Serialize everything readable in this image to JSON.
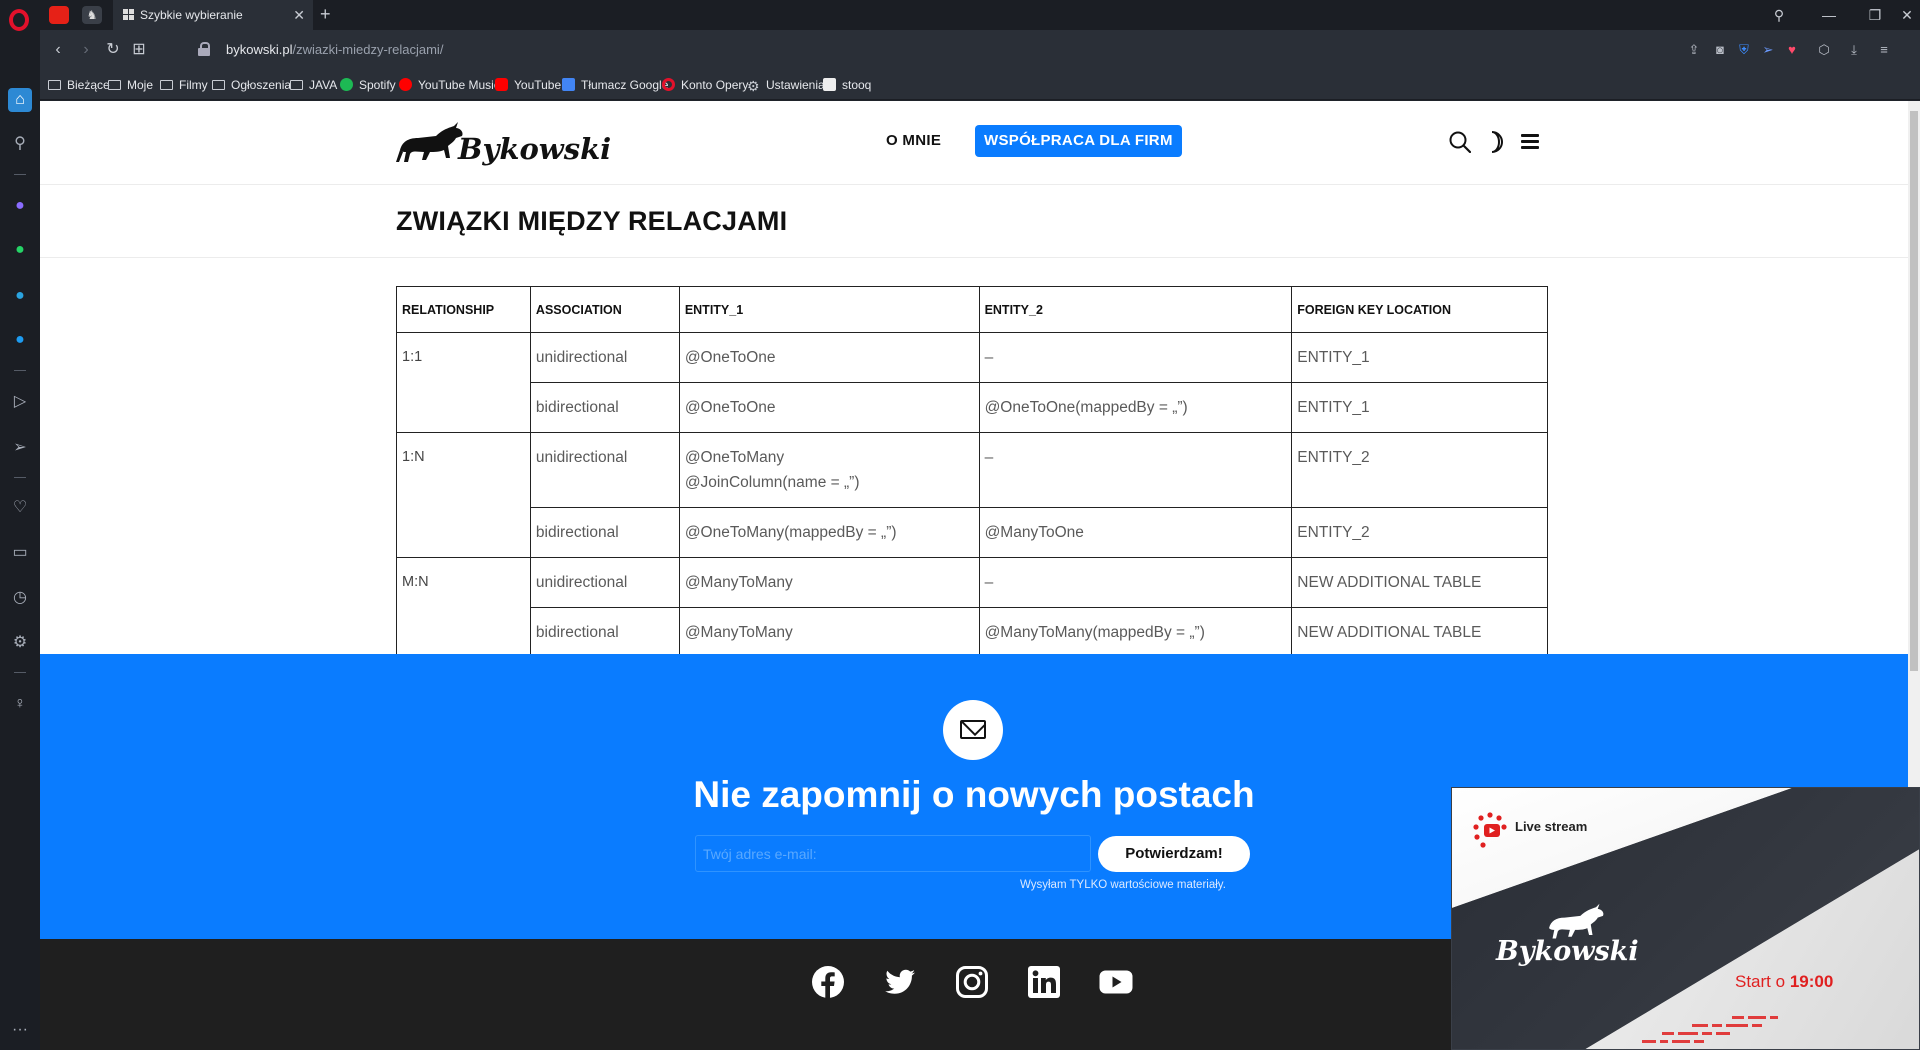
{
  "browser": {
    "tab_title": "Szybkie wybieranie",
    "url_domain": "bykowski.pl",
    "url_path": "/zwiazki-miedzy-relacjami/",
    "bookmarks": [
      "Bieżące",
      "Moje",
      "Filmy",
      "Ogłoszenia",
      "JAVA",
      "Spotify",
      "YouTube Music",
      "YouTube",
      "Tłumacz Google",
      "Konto Opery",
      "Ustawienia",
      "stooq"
    ]
  },
  "header": {
    "brand": "Bykowski",
    "nav_about": "O MNIE",
    "nav_cta": "WSPÓŁPRACA DLA FIRM"
  },
  "page": {
    "title": "ZWIĄZKI MIĘDZY RELACJAMI"
  },
  "table": {
    "headers": [
      "RELATIONSHIP",
      "ASSOCIATION",
      "ENTITY_1",
      "ENTITY_2",
      "FOREIGN KEY LOCATION"
    ],
    "groups": [
      {
        "relationship": "1:1",
        "rows": [
          [
            "unidirectional",
            "@OneToOne",
            "–",
            "ENTITY_1"
          ],
          [
            "bidirectional",
            "@OneToOne",
            "@OneToOne(mappedBy = „”)",
            "ENTITY_1"
          ]
        ]
      },
      {
        "relationship": "1:N",
        "rows": [
          [
            "unidirectional",
            "@OneToMany\n@JoinColumn(name = „”)",
            "–",
            "ENTITY_2"
          ],
          [
            "bidirectional",
            "@OneToMany(mappedBy = „”)",
            "@ManyToOne",
            "ENTITY_2"
          ]
        ]
      },
      {
        "relationship": "M:N",
        "rows": [
          [
            "unidirectional",
            "@ManyToMany",
            "–",
            "NEW ADDITIONAL TABLE"
          ],
          [
            "bidirectional",
            "@ManyToMany",
            "@ManyToMany(mappedBy = „”)",
            "NEW ADDITIONAL TABLE"
          ]
        ]
      }
    ]
  },
  "newsletter": {
    "title": "Nie zapomnij o nowych postach",
    "email_placeholder": "Twój adres e-mail:",
    "submit_label": "Potwierdzam!",
    "note": "Wysyłam TYLKO wartościowe materiały."
  },
  "footer": {
    "social": [
      "facebook-icon",
      "twitter-icon",
      "instagram-icon",
      "linkedin-icon",
      "youtube-icon"
    ]
  },
  "live_popup": {
    "label": "Live stream",
    "brand": "Bykowski",
    "start_prefix": "Start o",
    "start_time": "19:00"
  },
  "colors": {
    "accent": "#0a7cff",
    "footer": "#1f1f1f",
    "live_red": "#e02020"
  }
}
